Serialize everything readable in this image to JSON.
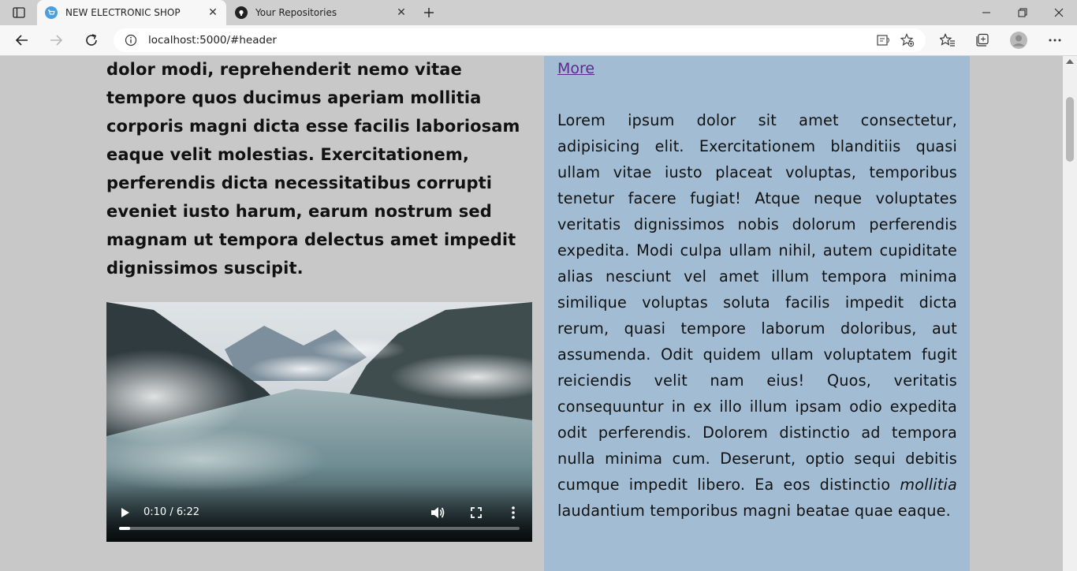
{
  "browser": {
    "tabs": [
      {
        "title": "NEW ELECTRONIC SHOP",
        "active": true,
        "icon": "shop-icon"
      },
      {
        "title": "Your Repositories",
        "active": false,
        "icon": "github-icon"
      }
    ],
    "address": "localhost:5000/#header"
  },
  "page": {
    "left_paragraph": "dolor modi, reprehenderit nemo vitae tempore quos ducimus aperiam mollitia corporis magni dicta esse facilis laboriosam eaque velit molestias. Exercitationem, perferendis dicta necessitatibus corrupti eveniet iusto harum, earum nostrum sed magnam ut tempora delectus amet impedit dignissimos suscipit.",
    "video": {
      "time": "0:10 / 6:22",
      "progress": 0.027
    },
    "aside": {
      "more_link": "More",
      "paragraph_main": "Lorem ipsum dolor sit amet consectetur, adipisicing elit. Exercitationem blanditiis quasi ullam vitae iusto placeat voluptas, temporibus tenetur facere fugiat! Atque neque voluptates veritatis dignissimos nobis dolorum perferendis expedita. Modi culpa ullam nihil, autem cupiditate alias nesciunt vel amet illum tempora minima similique voluptas soluta facilis impedit dicta rerum, quasi tempore laborum doloribus, aut assumenda. Odit quidem ullam voluptatem fugit reiciendis velit nam eius! Quos, veritatis consequuntur in ex illo illum ipsam odio expedita odit perferendis. Dolorem distinctio ad tempora nulla minima cum. Deserunt, optio sequi debitis cumque impedit libero. Ea eos distinctio ",
      "paragraph_italic": "mollitia",
      "paragraph_end": " laudantium temporibus magni beatae quae eaque."
    }
  },
  "colors": {
    "page_bg": "#c8c8c8",
    "aside_bg": "#a2bdd3",
    "link": "#5b2a8a"
  }
}
